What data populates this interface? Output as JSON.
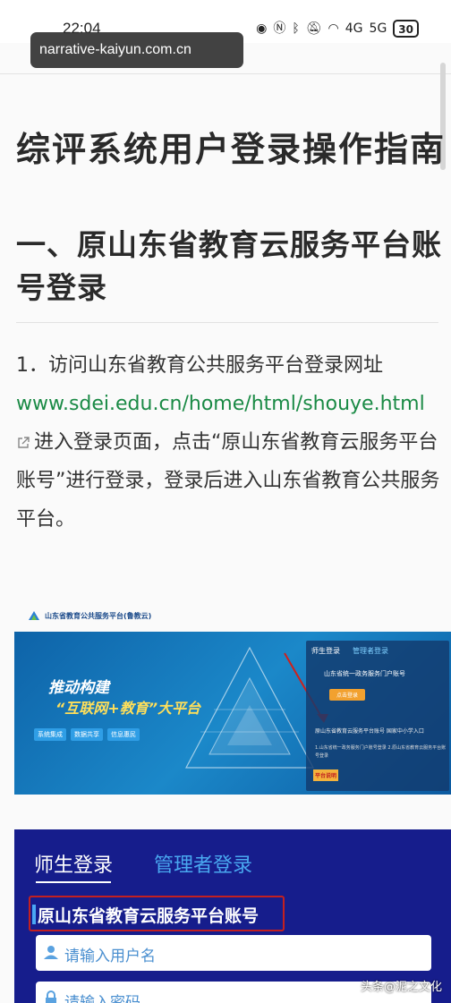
{
  "status_bar": {
    "time": "22:04",
    "network_4g": "4G",
    "network_5g": "5G",
    "battery": "30"
  },
  "url_toast": {
    "text": "narrative-kaiyun.com.cn"
  },
  "article": {
    "title": "综评系统用户登录操作指南",
    "section_heading": "一、原山东省教育云服务平台账号登录",
    "step_prefix": "1．访问山东省教育公共服务平台登录网址",
    "link_text": "www.sdei.edu.cn/home/html/shouye.html",
    "step_suffix": "进入登录页面，点击“原山东省教育云服务平台账号”进行登录，登录后进入山东省教育公共服务平台。"
  },
  "banner": {
    "caption": "山东省教育公共服务平台(鲁教云)",
    "title_line1": "推动构建",
    "title_line2": "“互联网+教育”大平台",
    "pills": [
      "系统集成",
      "数据共享",
      "信息惠民"
    ],
    "panel_tab_active": "师生登录",
    "panel_tab_inactive": "管理者登录",
    "panel_gov": "山东省统一政务服务门户账号",
    "panel_button": "点击登录",
    "panel_line1": "原山东省教育云服务平台账号   国家中小学入口",
    "panel_line2": "1.山东省统一政务服务门户账号登录  2.原山东省教育云服务平台账号登录",
    "panel_badge": "平台说明"
  },
  "login_screenshot": {
    "tab_active": "师生登录",
    "tab_inactive": "管理者登录",
    "account_label": "原山东省教育云服务平台账号",
    "username_placeholder": "请输入用户名",
    "password_placeholder": "请输入密码"
  },
  "watermark": "头条@泥之文化",
  "colors": {
    "link": "#1a8a45",
    "login_bg": "#161d8c",
    "highlight_border": "#c32020"
  }
}
